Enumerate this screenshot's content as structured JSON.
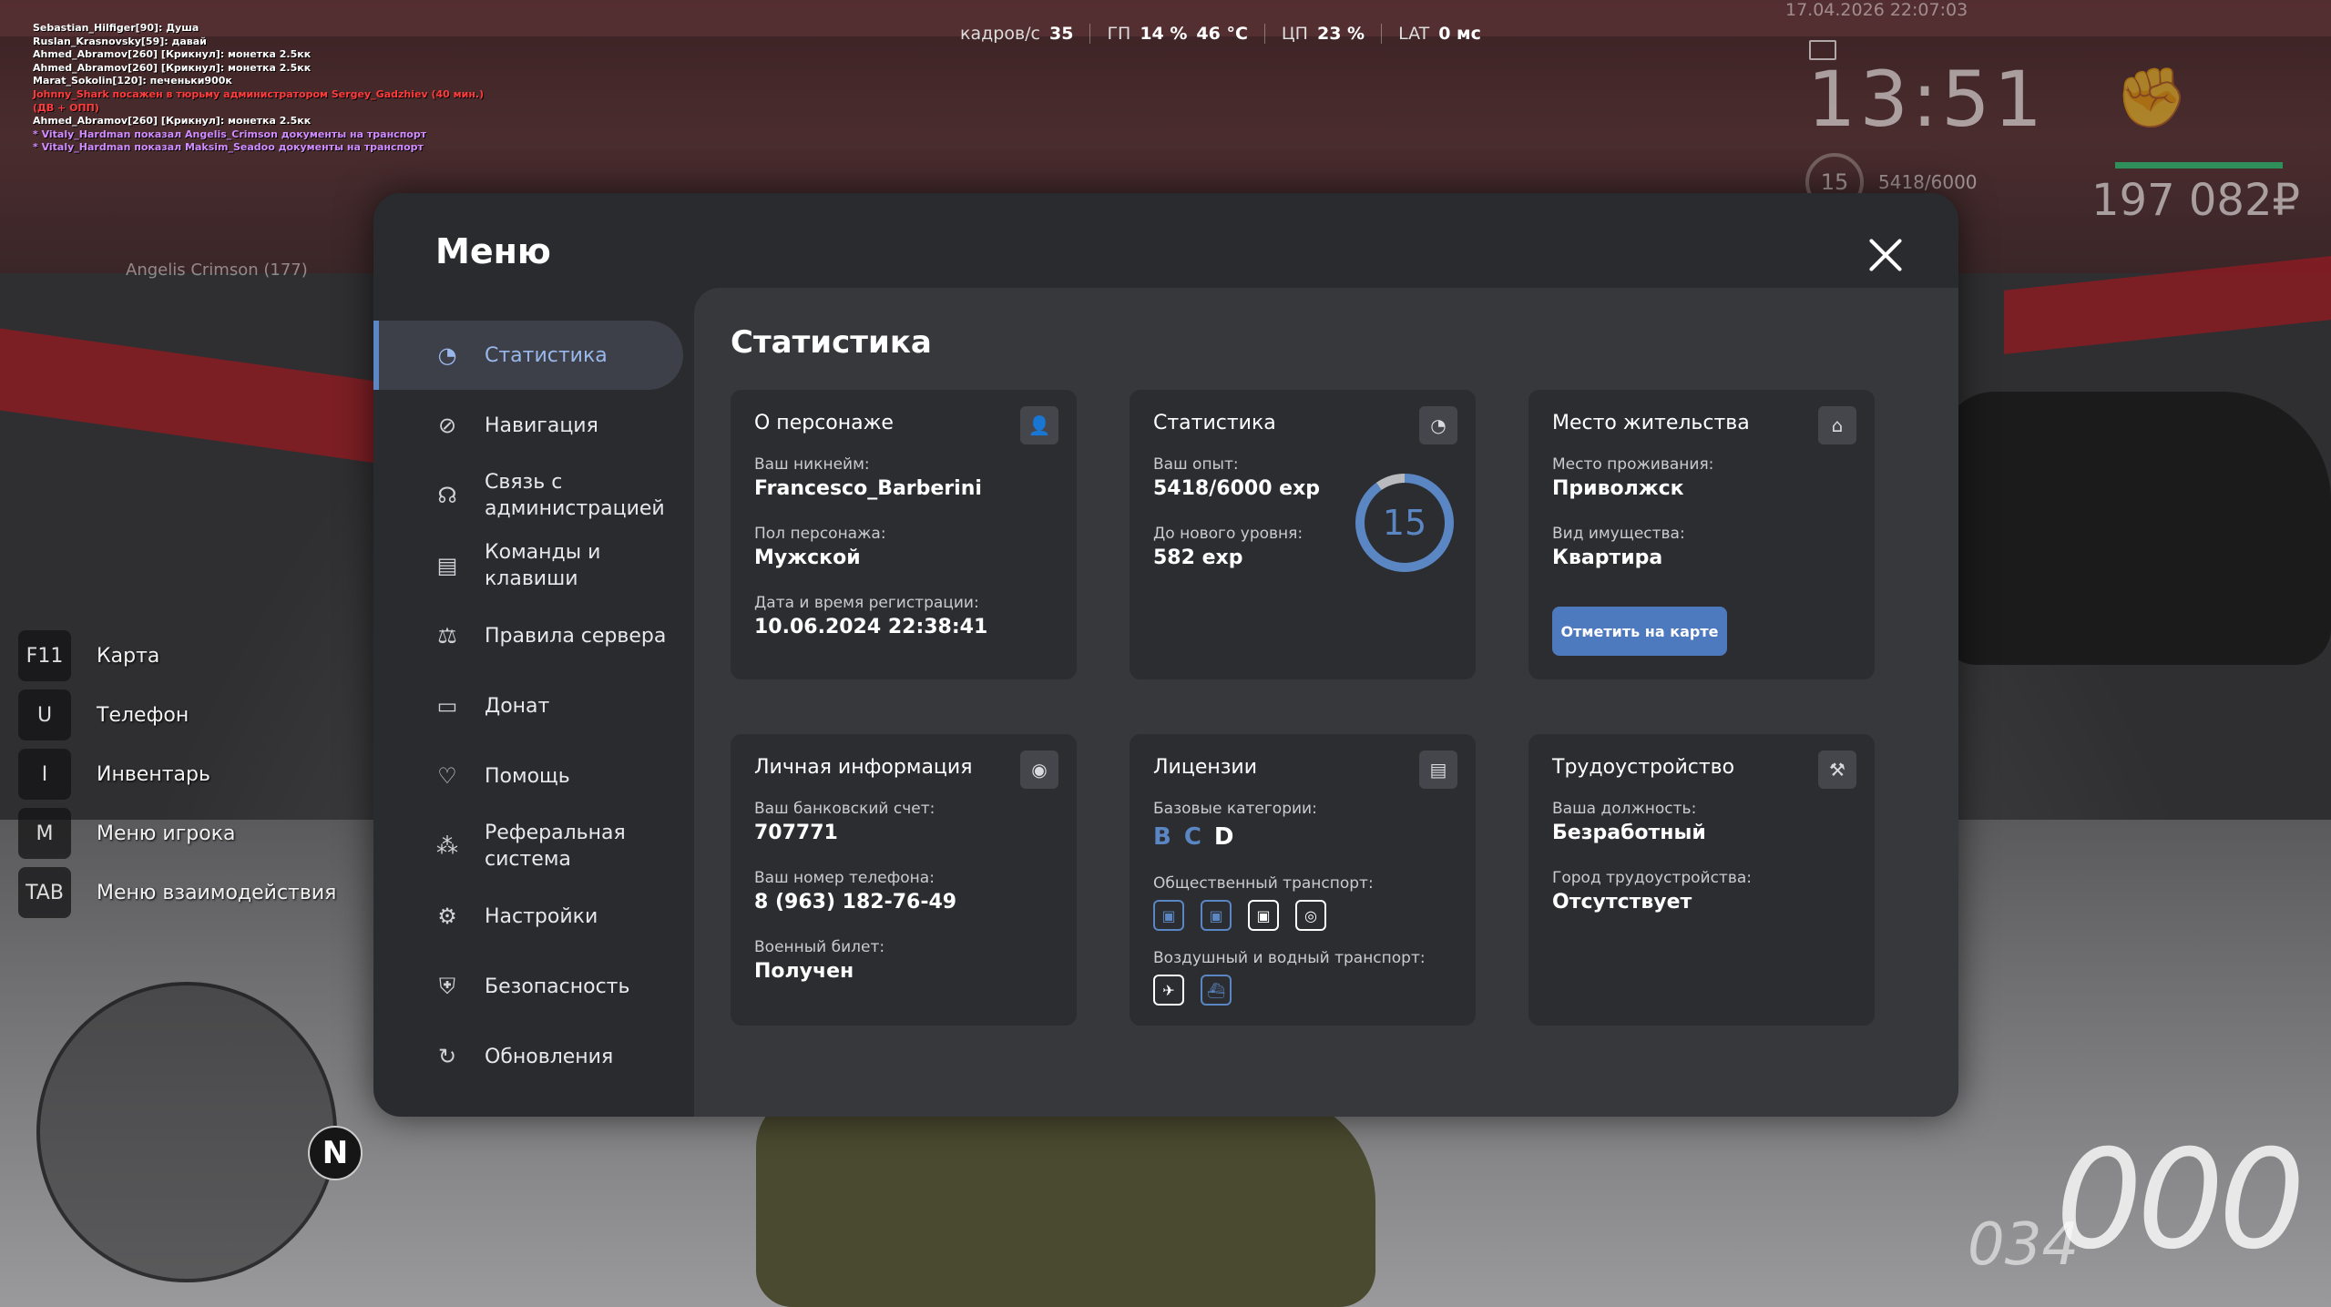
{
  "chat": [
    {
      "text": "Sebastian_Hilfiger[90]: Душа",
      "color": "#ffffff"
    },
    {
      "text": "Ruslan_Krasnovsky[59]: давай",
      "color": "#ffffff"
    },
    {
      "text": "Ahmed_Abramov[260] [Крикнул]: монетка 2.5кк",
      "color": "#ffffff"
    },
    {
      "text": "Ahmed_Abramov[260] [Крикнул]: монетка 2.5кк",
      "color": "#ffffff"
    },
    {
      "text": "Marat_Sokolin[120]: печеньки900к",
      "color": "#ffffff"
    },
    {
      "text": "Johnny_Shark посажен в тюрьму администратором Sergey_Gadzhiev (40 мин.)",
      "color": "#ff3b3b"
    },
    {
      "text": "(ДВ + ОПП)",
      "color": "#ff3b3b"
    },
    {
      "text": "Ahmed_Abramov[260] [Крикнул]: монетка 2.5кк",
      "color": "#ffffff"
    },
    {
      "text": "* Vitaly_Hardman показал Angelis_Crimson документы на транспорт",
      "color": "#d18cff"
    },
    {
      "text": "* Vitaly_Hardman показал Maksim_Seadoo документы на транспорт",
      "color": "#d18cff"
    }
  ],
  "hud": {
    "fps_label": "кадров/с",
    "fps_value": "35",
    "gpu_label": "ГП",
    "gpu_load": "14 %",
    "gpu_temp": "46 °C",
    "cpu_label": "ЦП",
    "cpu_load": "23 %",
    "lat_label": "LAT",
    "lat_value": "0 мс",
    "datetime": "17.04.2026 22:07:03",
    "clock": "13:51",
    "level": "15",
    "exp": "5418/6000",
    "money": "197 082₽",
    "name_tag": "Angelis Crimson (177)",
    "speed": "000",
    "fuel": "034",
    "north": "N"
  },
  "hints": [
    {
      "key": "F11",
      "label": "Карта"
    },
    {
      "key": "U",
      "label": "Телефон"
    },
    {
      "key": "I",
      "label": "Инвентарь"
    },
    {
      "key": "M",
      "label": "Меню игрока"
    },
    {
      "key": "TAB",
      "label": "Меню взаимодействия"
    }
  ],
  "menu": {
    "title": "Меню",
    "nav": [
      {
        "label": "Статистика",
        "icon": "pie-chart-icon",
        "active": true
      },
      {
        "label": "Навигация",
        "icon": "compass-icon"
      },
      {
        "label": "Связь с\nадминистрацией",
        "icon": "headset-icon"
      },
      {
        "label": "Команды и\nклавиши",
        "icon": "document-icon"
      },
      {
        "label": "Правила сервера",
        "icon": "scales-icon"
      },
      {
        "label": "Донат",
        "icon": "wallet-icon"
      },
      {
        "label": "Помощь",
        "icon": "handshake-icon"
      },
      {
        "label": "Реферальная\nсистема",
        "icon": "referral-icon"
      },
      {
        "label": "Настройки",
        "icon": "gear-icon"
      },
      {
        "label": "Безопасность",
        "icon": "shield-icon"
      },
      {
        "label": "Обновления",
        "icon": "refresh-icon"
      }
    ],
    "section_title": "Статистика"
  },
  "cards": {
    "character": {
      "title": "О персонаже",
      "nick_label": "Ваш никнейм:",
      "nick": "Francesco_Barberini",
      "gender_label": "Пол персонажа:",
      "gender": "Мужской",
      "reg_label": "Дата и время регистрации:",
      "reg": "10.06.2024 22:38:41"
    },
    "stats": {
      "title": "Статистика",
      "exp_label": "Ваш опыт:",
      "exp": "5418/6000 exp",
      "next_label": "До нового уровня:",
      "next": "582 exp",
      "level": "15",
      "progress": 0.903
    },
    "residence": {
      "title": "Место жительства",
      "place_label": "Место проживания:",
      "place": "Приволжск",
      "type_label": "Вид имущества:",
      "type": "Квартира",
      "button": "Отметить на карте"
    },
    "personal": {
      "title": "Личная информация",
      "bank_label": "Ваш банковский счет:",
      "bank": "707771",
      "phone_label": "Ваш номер телефона:",
      "phone": "8 (963) 182-76-49",
      "military_label": "Военный билет:",
      "military": "Получен"
    },
    "licenses": {
      "title": "Лицензии",
      "base_label": "Базовые категории:",
      "categories": [
        "B",
        "C",
        "D"
      ],
      "public_label": "Общественный транспорт:",
      "air_label": "Воздушный и водный транспорт:"
    },
    "job": {
      "title": "Трудоустройство",
      "position_label": "Ваша должность:",
      "position": "Безработный",
      "city_label": "Город трудоустройства:",
      "city": "Отсутствует"
    }
  }
}
